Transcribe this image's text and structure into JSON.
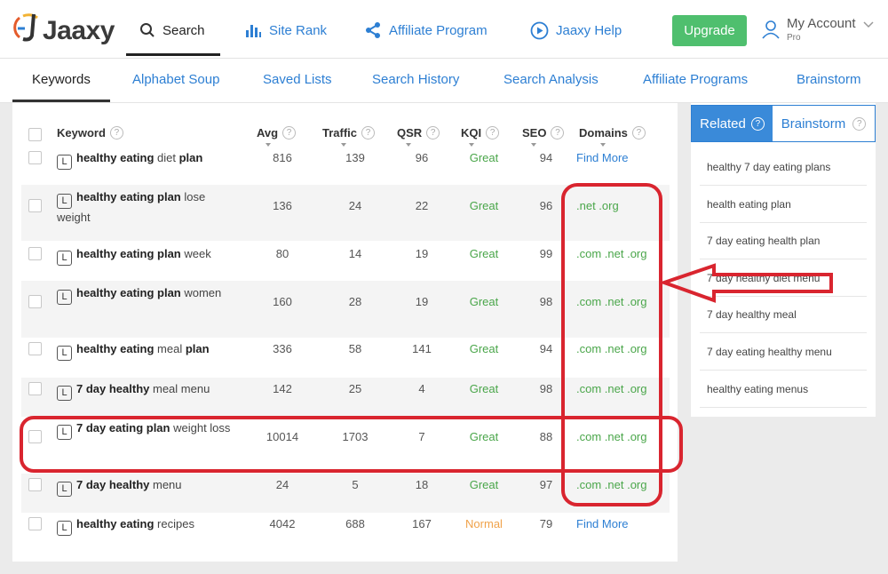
{
  "brand": {
    "name": "Jaaxy"
  },
  "nav": {
    "search": "Search",
    "site_rank": "Site Rank",
    "affiliate_program": "Affiliate Program",
    "help": "Jaaxy Help",
    "upgrade": "Upgrade",
    "account": "My Account",
    "account_plan": "Pro"
  },
  "subnav": [
    "Keywords",
    "Alphabet Soup",
    "Saved Lists",
    "Search History",
    "Search Analysis",
    "Affiliate Programs",
    "Brainstorm"
  ],
  "table": {
    "headers": {
      "keyword": "Keyword",
      "avg": "Avg",
      "traffic": "Traffic",
      "qsr": "QSR",
      "kqi": "KQI",
      "seo": "SEO",
      "domains": "Domains"
    },
    "badge": "L",
    "rows": [
      {
        "kw_html": "<b>healthy eating</b> diet <b>plan</b>",
        "avg": "816",
        "traffic": "139",
        "qsr": "96",
        "kqi": "Great",
        "seo": "94",
        "domains": "Find More"
      },
      {
        "kw_html": "<b>healthy eating plan</b> lose weight",
        "avg": "136",
        "traffic": "24",
        "qsr": "22",
        "kqi": "Great",
        "seo": "96",
        "domains": ".net .org"
      },
      {
        "kw_html": "<b>healthy eating plan</b> week",
        "avg": "80",
        "traffic": "14",
        "qsr": "19",
        "kqi": "Great",
        "seo": "99",
        "domains": ".com .net .org"
      },
      {
        "kw_html": "<b>healthy eating plan</b> women",
        "avg": "160",
        "traffic": "28",
        "qsr": "19",
        "kqi": "Great",
        "seo": "98",
        "domains": ".com .net .org"
      },
      {
        "kw_html": "<b>healthy eating</b> meal <b>plan</b>",
        "avg": "336",
        "traffic": "58",
        "qsr": "141",
        "kqi": "Great",
        "seo": "94",
        "domains": ".com .net .org"
      },
      {
        "kw_html": "<b>7 day healthy</b> meal menu",
        "avg": "142",
        "traffic": "25",
        "qsr": "4",
        "kqi": "Great",
        "seo": "98",
        "domains": ".com .net .org"
      },
      {
        "kw_html": "<b>7 day eating plan</b> weight loss",
        "avg": "10014",
        "traffic": "1703",
        "qsr": "7",
        "kqi": "Great",
        "seo": "88",
        "domains": ".com .net .org"
      },
      {
        "kw_html": "<b>7 day healthy</b> menu",
        "avg": "24",
        "traffic": "5",
        "qsr": "18",
        "kqi": "Great",
        "seo": "97",
        "domains": ".com .net .org"
      },
      {
        "kw_html": "<b>healthy eating</b> recipes",
        "avg": "4042",
        "traffic": "688",
        "qsr": "167",
        "kqi": "Normal",
        "seo": "79",
        "domains": "Find More"
      }
    ]
  },
  "side": {
    "tab_related": "Related",
    "tab_brainstorm": "Brainstorm",
    "items": [
      "healthy 7 day eating plans",
      "health eating plan",
      "7 day eating health plan",
      "7 day healthy diet menu",
      "7 day healthy meal",
      "7 day eating healthy menu",
      "healthy eating menus"
    ]
  },
  "colors": {
    "accent": "#2d7fd3",
    "great": "#4aa64a",
    "normal": "#f0a24a",
    "upgrade": "#4fbf6e",
    "annotation": "#d9252f"
  }
}
